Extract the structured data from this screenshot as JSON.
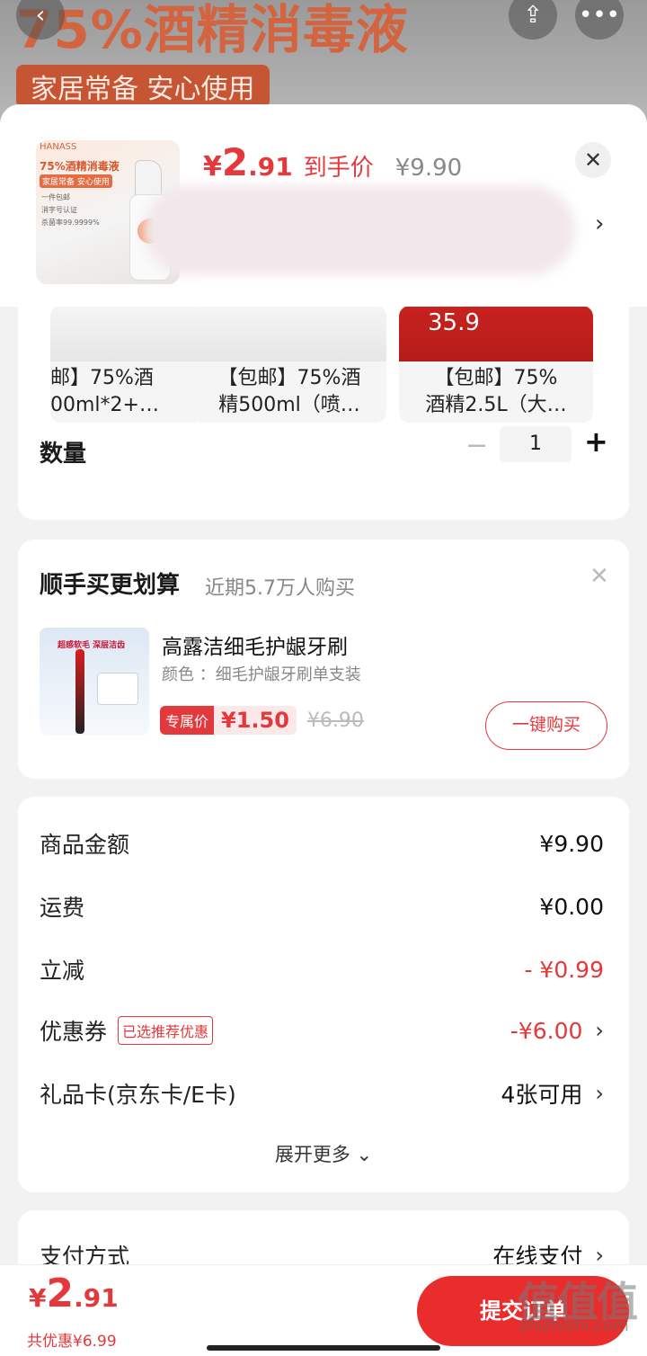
{
  "background": {
    "title": "75%酒精消毒液",
    "subtitle": "家居常备 安心使用"
  },
  "header": {
    "price_yen": "¥",
    "price_int": "2",
    "price_dec": ".91",
    "price_tag": "到手价",
    "original_price": "¥9.90",
    "thumb_title": "75%酒精消毒液",
    "thumb_brand": "HANASS",
    "thumb_chip": "家居常备 安心使用",
    "thumb_bullets": [
      "一件包邮",
      "消字号认证",
      "杀菌率99.9999%"
    ]
  },
  "variants": [
    {
      "label_line1": "邮】75%酒",
      "label_line2": "00ml*2+…",
      "red": false
    },
    {
      "label_line1": "【包邮】75%酒",
      "label_line2": "精500ml（喷…",
      "red": false
    },
    {
      "label_line1": "【包邮】75%",
      "label_line2": "酒精2.5L（大…",
      "red": true,
      "image_price": "35.9"
    }
  ],
  "quantity": {
    "label": "数量",
    "value": "1",
    "minus": "−",
    "plus": "+"
  },
  "addon": {
    "title": "顺手买更划算",
    "subtitle": "近期5.7万人购买",
    "product_name": "高露洁细毛护龈牙刷",
    "product_color": "颜色 ：细毛护龈牙刷单支装",
    "badge": "专属价",
    "price": "¥1.50",
    "original_price": "¥6.90",
    "buy_label": "一键购买",
    "image_text": "超感软毛 深层洁齿"
  },
  "summary": {
    "rows": [
      {
        "label": "商品金额",
        "value": "¥9.90"
      },
      {
        "label": "运费",
        "value": "¥0.00"
      },
      {
        "label": "立减",
        "value": "- ¥0.99"
      },
      {
        "label": "优惠券",
        "tag": "已选推荐优惠",
        "value": "-¥6.00"
      },
      {
        "label": "礼品卡(京东卡/E卡)",
        "value": "4张可用"
      }
    ],
    "expand_label": "展开更多 ⌄"
  },
  "payment": {
    "label": "支付方式",
    "value": "在线支付"
  },
  "bottom_bar": {
    "price_yen": "¥",
    "price_int": "2",
    "price_dec": ".91",
    "saved": "共优惠¥6.99",
    "submit_label": "提交订单"
  },
  "watermark": {
    "text": "值值值",
    "url": "zhizhizhi.com"
  },
  "colors": {
    "accent": "#e4393c",
    "submit": "#e92d2d"
  }
}
